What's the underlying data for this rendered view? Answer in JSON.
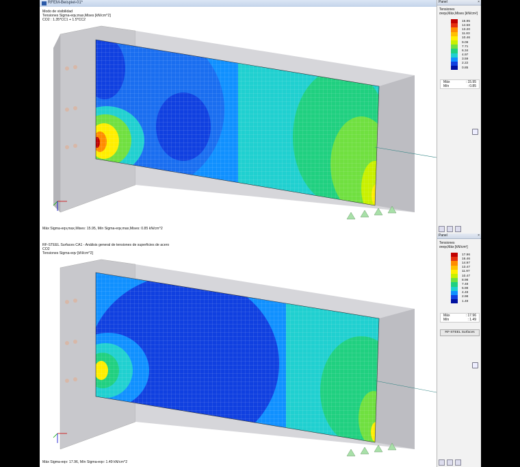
{
  "top": {
    "window_title": "RFEM-Beispiel-01*",
    "info_lines": [
      "Modo de visibilidad",
      "Tensiones Sigma-eqv,max,Mises [kN/cm^2]",
      "CO2 : 1.35*CC1 + 1.5*CC2"
    ],
    "status": "Máx Sigma-eqv,max,Mises: 15.95, Mín Sigma-eqv,max,Mises: 0.85 kN/cm^2",
    "panel": {
      "header": "Panel",
      "title": "Tensiones",
      "unit": "σeqv,Máx,Mises [kN/cm²]",
      "legend": [
        {
          "value": "15.95",
          "color": "#c00000"
        },
        {
          "value": "14.58",
          "color": "#e53010"
        },
        {
          "value": "13.20",
          "color": "#ff8c00"
        },
        {
          "value": "11.83",
          "color": "#ffc000"
        },
        {
          "value": "10.46",
          "color": "#ffee00"
        },
        {
          "value": "9.09",
          "color": "#c8f000"
        },
        {
          "value": "7.71",
          "color": "#70e040"
        },
        {
          "value": "6.34",
          "color": "#20d080"
        },
        {
          "value": "4.97",
          "color": "#20d0d0"
        },
        {
          "value": "3.59",
          "color": "#1090ff"
        },
        {
          "value": "2.22",
          "color": "#1040e0"
        },
        {
          "value": "0.85",
          "color": "#0010a0"
        }
      ],
      "max_label": "Máx",
      "max_value": ": 15.95",
      "min_label": "Mín",
      "min_value": ": 0.85"
    }
  },
  "bottom": {
    "info_lines": [
      "RF-STEEL Surfaces CA1 - Análisis general de tensiones de superficies de acero",
      "CO2",
      "Tensiones Sigma-eqv [kN/cm^2]"
    ],
    "status": "Máx Sigma-eqv: 17.96, Mín Sigma-eqv: 1.49 kN/cm^2",
    "panel": {
      "header": "Panel",
      "title": "Tensiones",
      "unit": "σeqv,Máx [kN/cm²]",
      "legend": [
        {
          "value": "17.96",
          "color": "#c00000"
        },
        {
          "value": "16.46",
          "color": "#e53010"
        },
        {
          "value": "14.97",
          "color": "#ff8c00"
        },
        {
          "value": "13.47",
          "color": "#ffc000"
        },
        {
          "value": "11.97",
          "color": "#ffee00"
        },
        {
          "value": "10.47",
          "color": "#c8f000"
        },
        {
          "value": "8.98",
          "color": "#70e040"
        },
        {
          "value": "7.48",
          "color": "#20d080"
        },
        {
          "value": "5.98",
          "color": "#20d0d0"
        },
        {
          "value": "4.48",
          "color": "#1090ff"
        },
        {
          "value": "2.98",
          "color": "#1040e0"
        },
        {
          "value": "1.49",
          "color": "#0010a0"
        }
      ],
      "max_label": "Máx",
      "max_value": ": 17.96",
      "min_label": "Mín",
      "min_value": ": 1.49",
      "button": "RF-STEEL Surfaces"
    }
  }
}
